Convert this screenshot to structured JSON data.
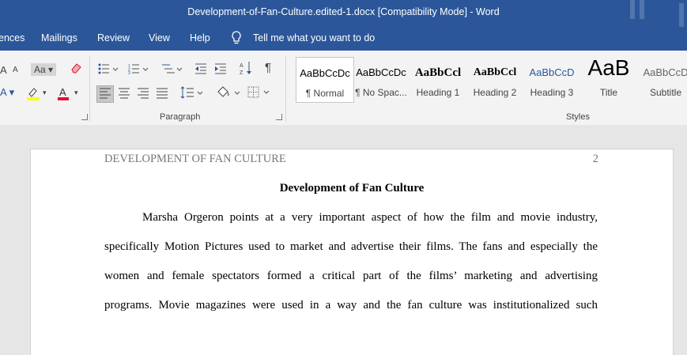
{
  "window": {
    "title": "Development-of-Fan-Culture.edited-1.docx [Compatibility Mode]  -  Word"
  },
  "tabs": [
    "ences",
    "Mailings",
    "Review",
    "View",
    "Help"
  ],
  "tell_me": "Tell me what you want to do",
  "ribbon": {
    "groups": {
      "paragraph": "Paragraph",
      "styles": "Styles"
    },
    "font": {
      "change_case": "Aa",
      "shrink": "A",
      "grow": "A"
    },
    "styles": [
      {
        "sample": "AaBbCcDc",
        "name": "¶ Normal"
      },
      {
        "sample": "AaBbCcDc",
        "name": "¶ No Spac..."
      },
      {
        "sample": "AaBbCcl",
        "name": "Heading 1"
      },
      {
        "sample": "AaBbCcl",
        "name": "Heading 2"
      },
      {
        "sample": "AaBbCcD",
        "name": "Heading 3"
      },
      {
        "sample": "AaB",
        "name": "Title"
      },
      {
        "sample": "AaBbCcD",
        "name": "Subtitle"
      }
    ],
    "colors": {
      "accent": "#2b579a",
      "highlight": "#ffff00",
      "font_color": "#e81123"
    }
  },
  "document": {
    "header": "DEVELOPMENT OF FAN CULTURE",
    "page_number": "2",
    "title": "Development of Fan Culture",
    "lines": [
      "Marsha Orgeron points at a very important aspect of how the film and movie industry,",
      "specifically Motion Pictures used to market and advertise their films.  The fans and especially the",
      "women and female spectators formed a critical part of the films’ marketing and advertising",
      "programs. Movie magazines were used in a way and the fan culture was institutionalized such"
    ]
  }
}
